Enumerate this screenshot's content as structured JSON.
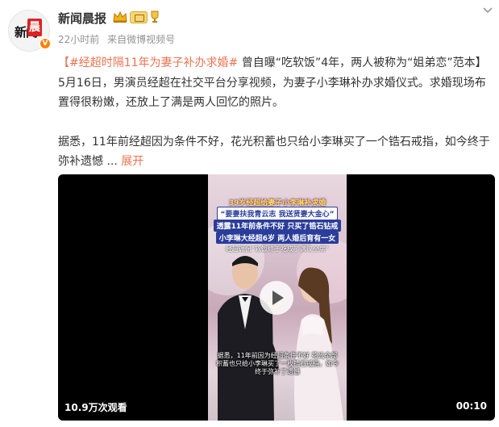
{
  "post": {
    "author": "新闻晨报",
    "avatar_text": {
      "part1": "新闻",
      "part2": "晨"
    },
    "verified_mark": "V",
    "time": "22小时前",
    "source_prefix": "来自",
    "source": "微博视频号",
    "hashtag": "【#经超时隔11年为妻子补办求婚#",
    "text1": " 曾自曝“吃软饭”4年，两人被称为“姐弟恋”范本】5月16日，男演员经超在社交平台分享视频，为妻子小李琳补办求婚仪式。求婚现场布置得很粉嫩，还放上了满是两人回忆的照片。",
    "text2": "据悉，11年前经超因为条件不好，花光积蓄也只给小李琳买了一个锆石戒指，如今终于弥补遗憾 ",
    "expand_dots": "...",
    "expand_label": "展开"
  },
  "video": {
    "caption_lines": [
      "39岁经超给妻子小李琳补求婚",
      "“要妻扶我青云志 我送贤妻大金心”",
      "透露11年前条件不好 只买了锆石钻戒",
      "小李琳大经超6岁 两人婚后育有一女",
      "经超调侃“软饭终于吃成了满汉全席”"
    ],
    "subtitle": "据悉，11年前因为经超条件不好 花光全部积蓄也只给小李琳买了一枚锆石戒指，如今终于弥补了遗憾",
    "views": "10.9万次观看",
    "duration": "00:10"
  },
  "colors": {
    "accent": "#eb7350",
    "text": "#333333",
    "meta": "#939393",
    "badge_orange": "#ff8200"
  },
  "icons": [
    "crown-icon",
    "level-badge-icon",
    "trophy-icon",
    "chevron-down-icon",
    "play-icon",
    "verified-icon"
  ]
}
